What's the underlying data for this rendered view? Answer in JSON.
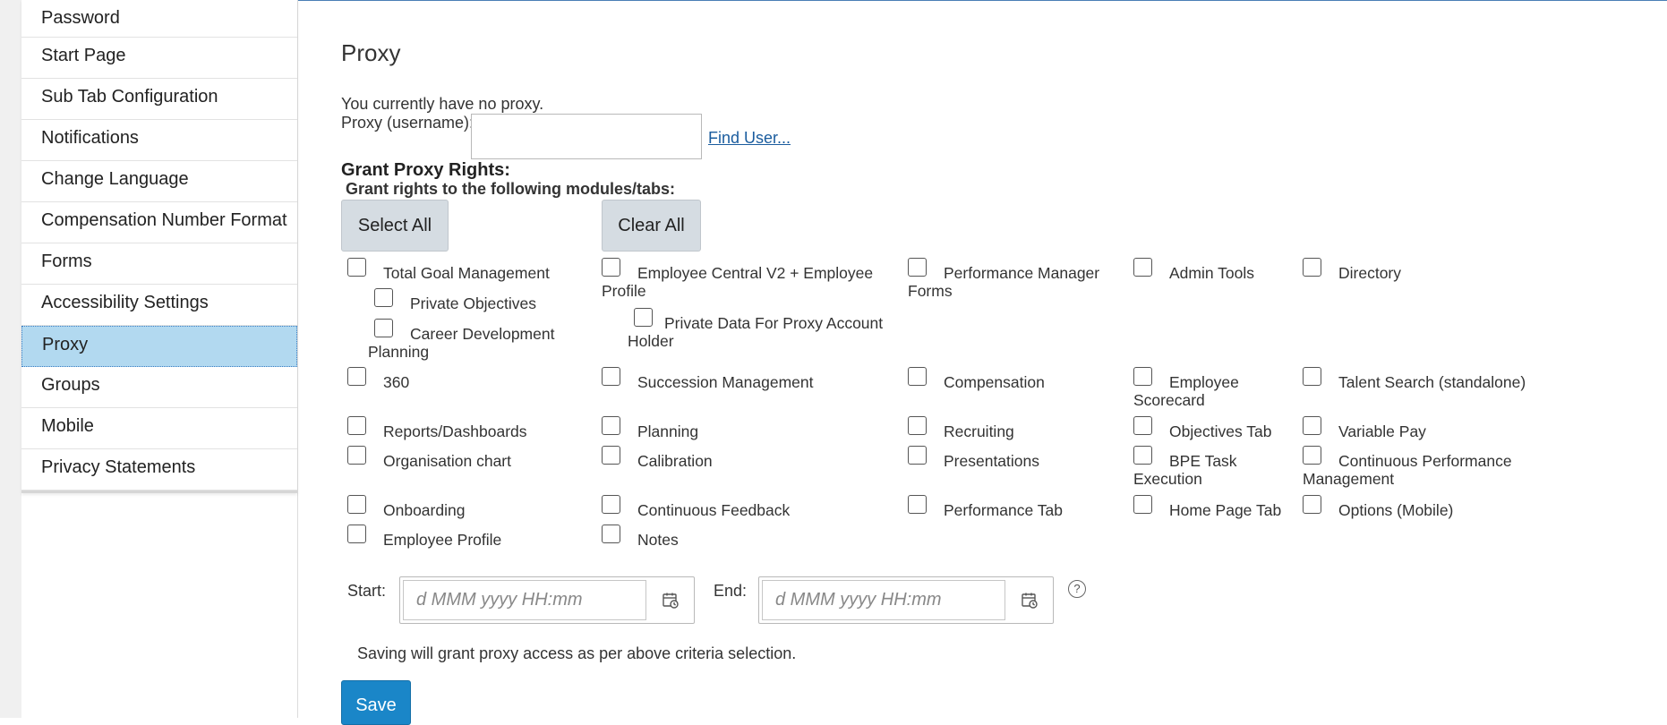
{
  "sidebar": {
    "items": [
      {
        "label": "Password"
      },
      {
        "label": "Start Page"
      },
      {
        "label": "Sub Tab Configuration"
      },
      {
        "label": "Notifications"
      },
      {
        "label": "Change Language"
      },
      {
        "label": "Compensation Number Format"
      },
      {
        "label": "Forms"
      },
      {
        "label": "Accessibility Settings"
      },
      {
        "label": "Proxy"
      },
      {
        "label": "Groups"
      },
      {
        "label": "Mobile"
      },
      {
        "label": "Privacy Statements"
      }
    ],
    "active": "Proxy"
  },
  "main": {
    "title": "Proxy",
    "no_proxy_text": "You currently have no proxy.",
    "proxy_label": "Proxy (username):",
    "proxy_value": "",
    "find_user": "Find User...",
    "grant_title": "Grant Proxy Rights:",
    "grant_subtitle": "Grant rights to the following modules/tabs:",
    "select_all": "Select All",
    "clear_all": "Clear All",
    "modules": [
      {
        "label": "Total Goal Management",
        "checked": false
      },
      {
        "label": "Private Objectives",
        "checked": false
      },
      {
        "label": "Career Development Planning",
        "checked": false
      },
      {
        "label": "Employee Central V2 + Employee Profile",
        "checked": false
      },
      {
        "label": "Private Data For Proxy Account Holder",
        "checked": false
      },
      {
        "label": "Performance Manager Forms",
        "checked": false
      },
      {
        "label": "Admin Tools",
        "checked": false
      },
      {
        "label": "Directory",
        "checked": false
      },
      {
        "label": "360",
        "checked": false
      },
      {
        "label": "Succession Management",
        "checked": false
      },
      {
        "label": "Compensation",
        "checked": false
      },
      {
        "label": "Employee Scorecard",
        "checked": false
      },
      {
        "label": "Talent Search (standalone)",
        "checked": false
      },
      {
        "label": "Reports/Dashboards",
        "checked": false
      },
      {
        "label": "Planning",
        "checked": false
      },
      {
        "label": "Recruiting",
        "checked": false
      },
      {
        "label": "Objectives Tab",
        "checked": false
      },
      {
        "label": "Variable Pay",
        "checked": false
      },
      {
        "label": "Organisation chart",
        "checked": false
      },
      {
        "label": "Calibration",
        "checked": false
      },
      {
        "label": "Presentations",
        "checked": false
      },
      {
        "label": "BPE Task Execution",
        "checked": false
      },
      {
        "label": "Continuous Performance Management",
        "checked": false
      },
      {
        "label": "Onboarding",
        "checked": false
      },
      {
        "label": "Continuous Feedback",
        "checked": false
      },
      {
        "label": "Performance Tab",
        "checked": false
      },
      {
        "label": "Home Page Tab",
        "checked": false
      },
      {
        "label": "Options (Mobile)",
        "checked": false
      },
      {
        "label": "Employee Profile",
        "checked": false
      },
      {
        "label": "Notes",
        "checked": false
      }
    ],
    "start_label": "Start:",
    "end_label": "End:",
    "date_placeholder": "d MMM yyyy HH:mm",
    "start_value": "",
    "end_value": "",
    "help_icon": "question-circle-icon",
    "calendar_icon": "calendar-clock-icon",
    "saving_note": "Saving will grant proxy access as per above criteria selection.",
    "save_label": "Save"
  },
  "colors": {
    "active_item": "#b2d9f0",
    "primary_button": "#1a86c8",
    "secondary_button": "#d5dce2",
    "link": "#1a5c9e"
  }
}
